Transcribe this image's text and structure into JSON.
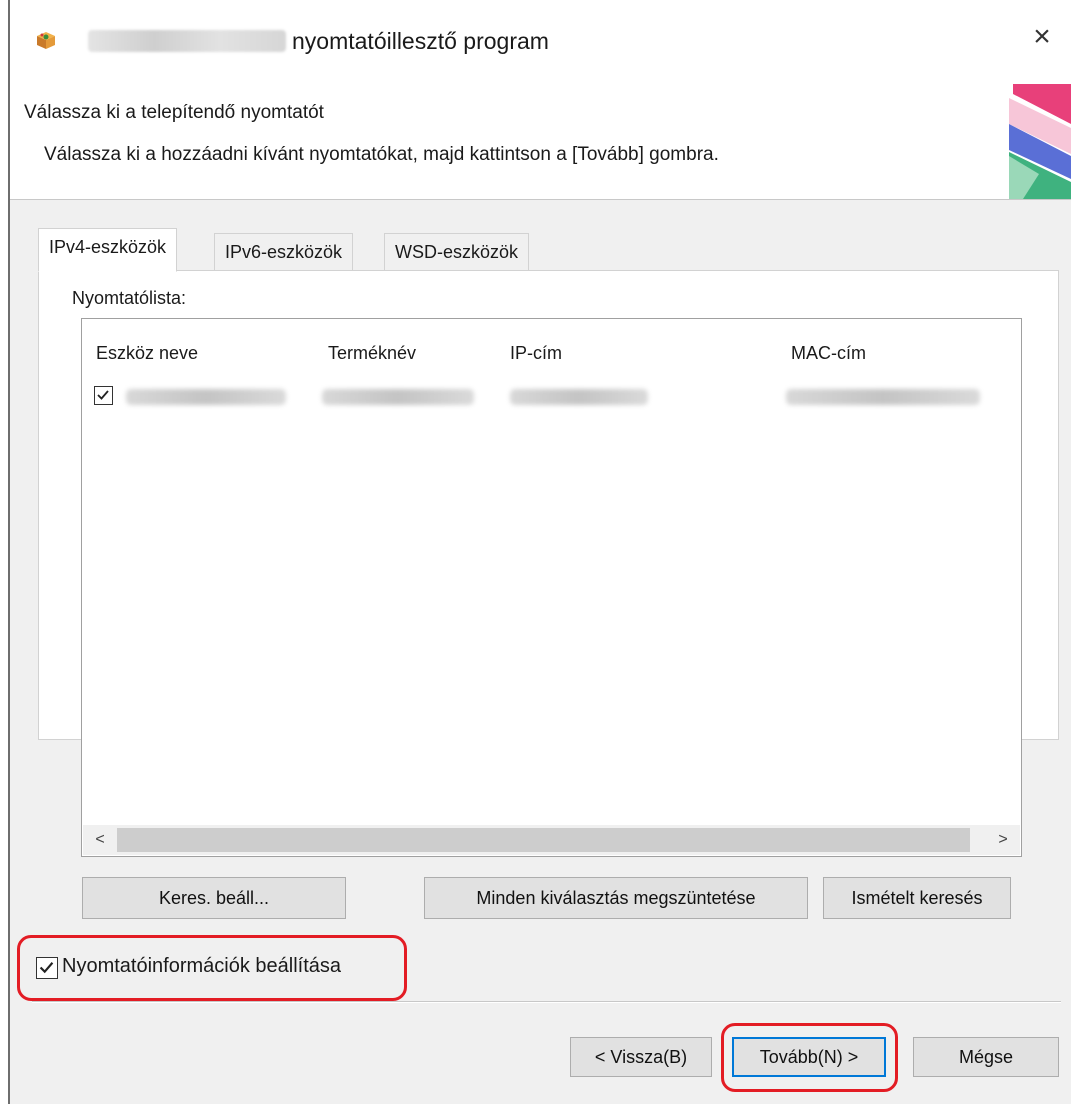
{
  "window": {
    "title": "nyomtatóillesztő program",
    "close_glyph": "×"
  },
  "header": {
    "title": "Válassza ki a telepítendő nyomtatót",
    "subtitle": "Válassza ki a hozzáadni kívánt nyomtatókat, majd kattintson a [Tovább] gombra."
  },
  "tabs": [
    {
      "label": "IPv4-eszközök",
      "active": true
    },
    {
      "label": "IPv6-eszközök",
      "active": false
    },
    {
      "label": "WSD-eszközök",
      "active": false
    }
  ],
  "printer_list": {
    "label": "Nyomtatólista:",
    "columns": [
      "Eszköz neve",
      "Terméknév",
      "IP-cím",
      "MAC-cím"
    ],
    "rows": [
      {
        "checked": true
      }
    ],
    "scroll_left": "<",
    "scroll_right": ">"
  },
  "buttons": {
    "search_settings": "Keres. beáll...",
    "deselect_all": "Minden kiválasztás megszüntetése",
    "search_again": "Ismételt keresés",
    "back": "< Vissza(B)",
    "next": "Tovább(N) >",
    "cancel": "Mégse"
  },
  "printer_info": {
    "label": "Nyomtatóinformációk beállítása",
    "checked": true
  },
  "colors": {
    "highlight": "#e31c24",
    "window_bg": "#f0f0f0",
    "focus_border": "#0078d7"
  },
  "icons": [
    "app-installer-icon",
    "close-icon",
    "checkbox-checked-icon",
    "chevron-left-icon",
    "chevron-right-icon"
  ]
}
